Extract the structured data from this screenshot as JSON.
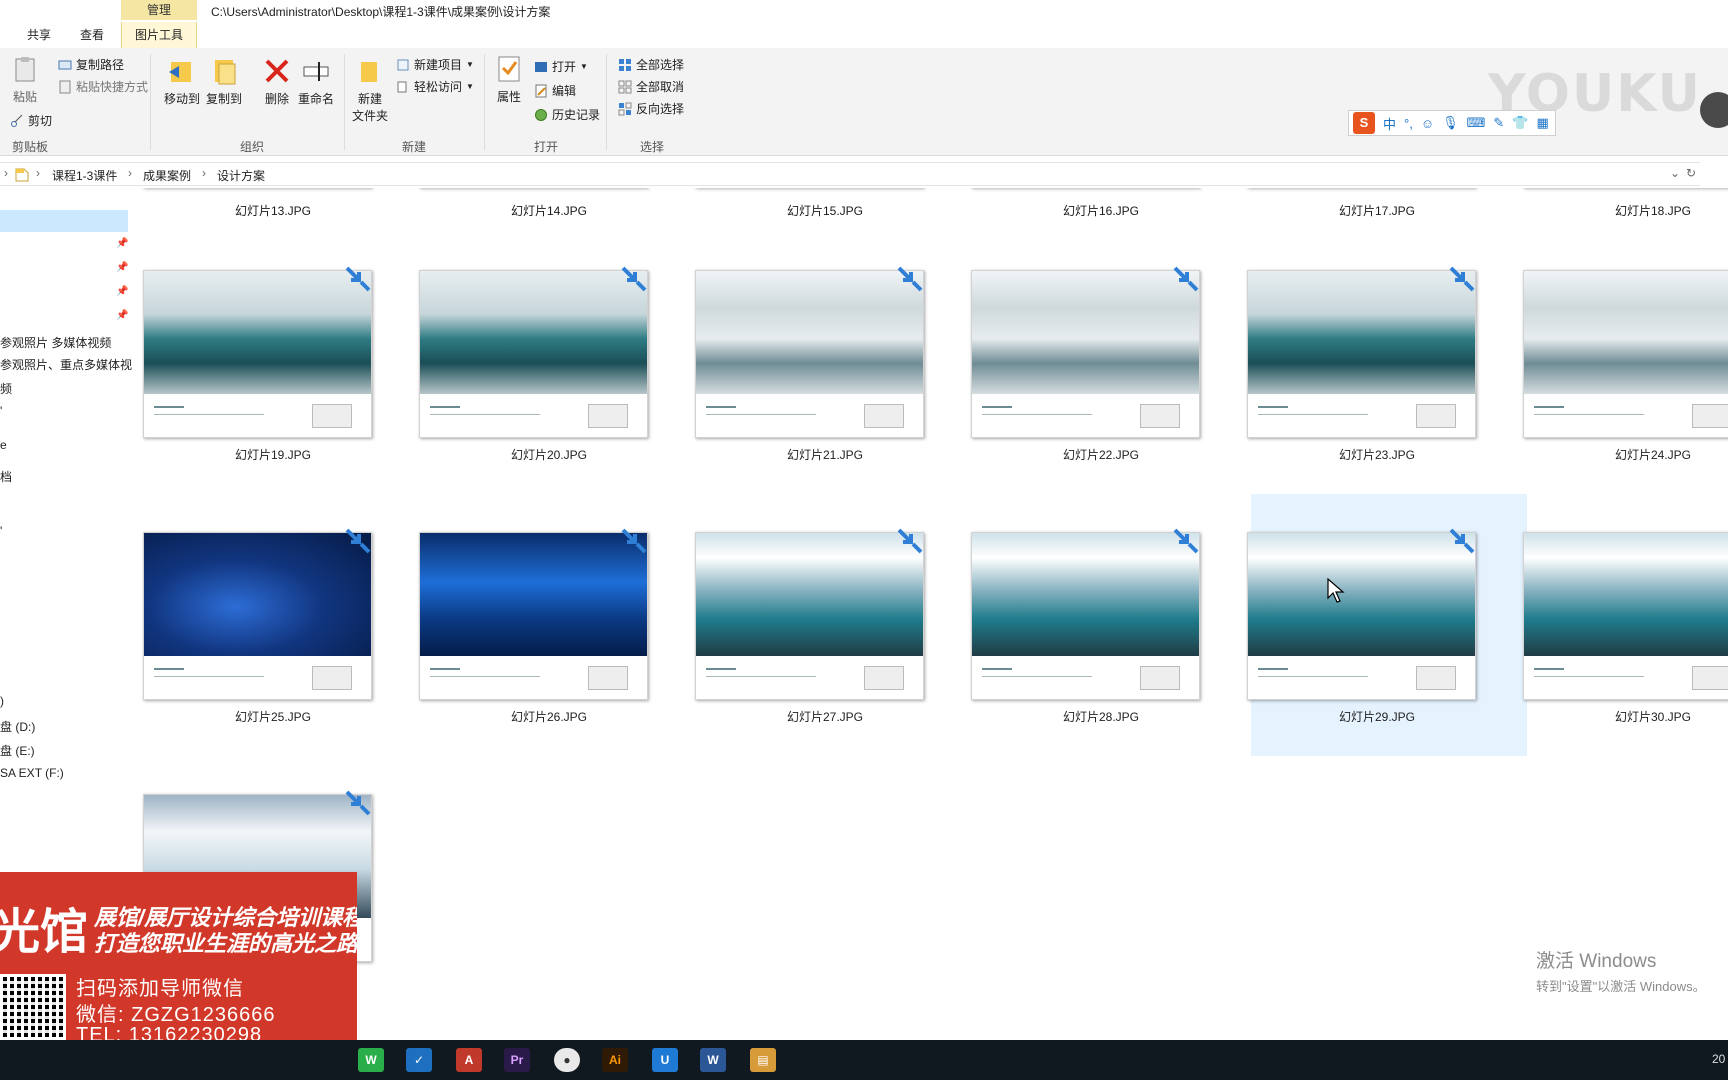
{
  "title_bar": {
    "manage_tab": "管理",
    "path": "C:\\Users\\Administrator\\Desktop\\课程1-3课件\\成果案例\\设计方案"
  },
  "tabs": {
    "share": "共享",
    "view": "查看",
    "picture_tools": "图片工具"
  },
  "ribbon": {
    "clipboard": {
      "paste": "粘贴",
      "copy_path": "复制路径",
      "paste_shortcut": "粘贴快捷方式",
      "cut": "剪切",
      "group": "剪贴板"
    },
    "organize": {
      "move_to": "移动到",
      "copy_to": "复制到",
      "delete": "删除",
      "rename": "重命名",
      "group": "组织"
    },
    "new": {
      "new_item": "新建项目",
      "easy_access": "轻松访问",
      "new_folder_line1": "新建",
      "new_folder_line2": "文件夹",
      "group": "新建"
    },
    "open": {
      "properties": "属性",
      "open": "打开",
      "edit": "编辑",
      "history": "历史记录",
      "group": "打开"
    },
    "select": {
      "select_all": "全部选择",
      "select_none": "全部取消",
      "invert": "反向选择",
      "group": "选择"
    }
  },
  "address_bar": {
    "crumbs": [
      "课程1-3课件",
      "成果案例",
      "设计方案"
    ]
  },
  "sidebar": {
    "items": [
      "参观照片 多媒体视频",
      "参观照片、重点多媒体视",
      "频",
      "'",
      "e",
      "档",
      "'",
      ")",
      "盘 (D:)",
      "盘 (E:)",
      "SA EXT (F:)"
    ]
  },
  "files": {
    "row0": [
      "幻灯片13.JPG",
      "幻灯片14.JPG",
      "幻灯片15.JPG",
      "幻灯片16.JPG",
      "幻灯片17.JPG",
      "幻灯片18.JPG"
    ],
    "row1": [
      "幻灯片19.JPG",
      "幻灯片20.JPG",
      "幻灯片21.JPG",
      "幻灯片22.JPG",
      "幻灯片23.JPG",
      "幻灯片24.JPG"
    ],
    "row2": [
      "幻灯片25.JPG",
      "幻灯片26.JPG",
      "幻灯片27.JPG",
      "幻灯片28.JPG",
      "幻灯片29.JPG",
      "幻灯片30.JPG"
    ],
    "selected": "幻灯片29.JPG"
  },
  "overlays": {
    "youku": "YOUKU",
    "ime": "中",
    "activate_title": "激活 Windows",
    "activate_sub": "转到\"设置\"以激活 Windows。",
    "ad_big": "光馆",
    "ad_line1": "展馆/展厅设计综合培训课程",
    "ad_line2": "打造您职业生涯的高光之路",
    "ad_contact1": "扫码添加导师微信",
    "ad_contact2": "微信: ZGZG1236666",
    "ad_contact3": "TEL: 13162230298"
  },
  "taskbar": {
    "apps": [
      "wechat-icon",
      "app-icon",
      "acrobat-icon",
      "premiere-icon",
      "chrome-icon",
      "illustrator-icon",
      "u-icon",
      "word-icon",
      "archive-icon"
    ],
    "clock": "20"
  }
}
